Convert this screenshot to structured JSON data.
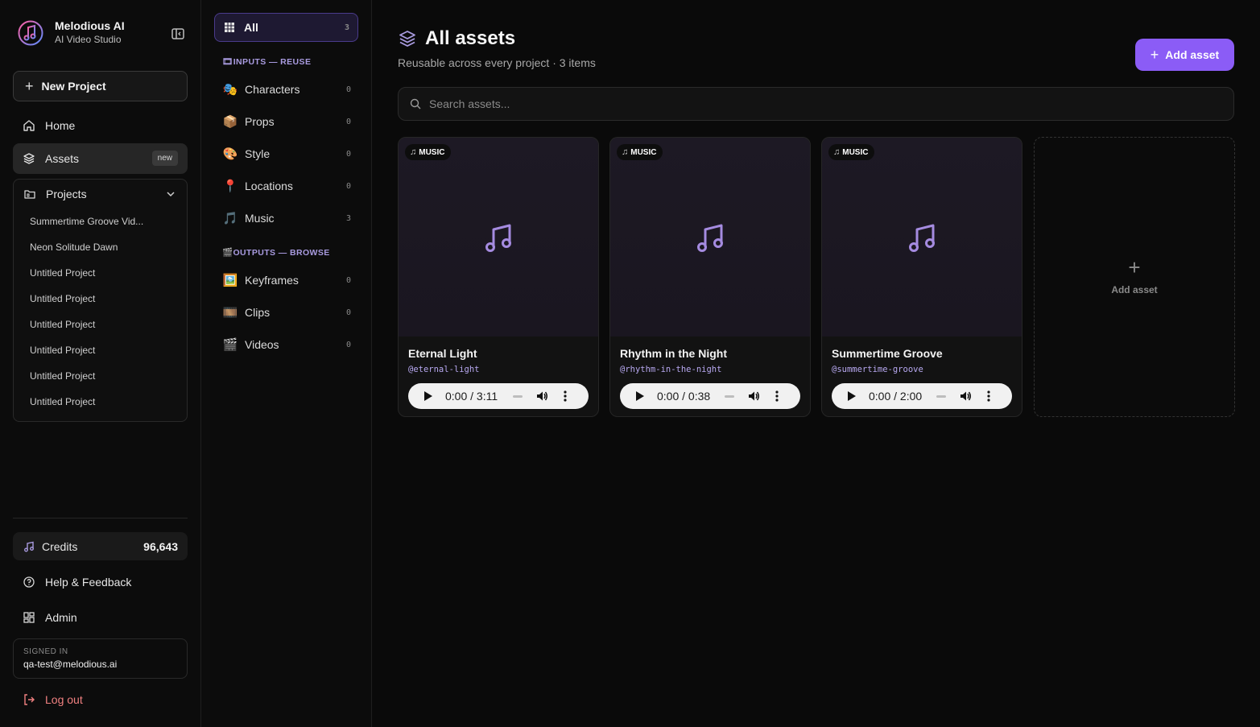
{
  "brand": {
    "name": "Melodious AI",
    "subtitle": "AI Video Studio"
  },
  "sidebar": {
    "new_project": "New Project",
    "home": "Home",
    "assets": "Assets",
    "assets_badge": "new",
    "projects_label": "Projects",
    "projects": [
      "Summertime Groove Vid...",
      "Neon Solitude Dawn",
      "Untitled Project",
      "Untitled Project",
      "Untitled Project",
      "Untitled Project",
      "Untitled Project",
      "Untitled Project"
    ],
    "credits_label": "Credits",
    "credits_value": "96,643",
    "help": "Help & Feedback",
    "admin": "Admin",
    "signed_in_label": "SIGNED IN",
    "signed_in_email": "qa-test@melodious.ai",
    "logout": "Log out"
  },
  "categories": {
    "all": {
      "label": "All",
      "count": "3"
    },
    "inputs_heading": "INPUTS — REUSE",
    "inputs": [
      {
        "emoji": "🎭",
        "label": "Characters",
        "count": "0"
      },
      {
        "emoji": "📦",
        "label": "Props",
        "count": "0"
      },
      {
        "emoji": "🎨",
        "label": "Style",
        "count": "0"
      },
      {
        "emoji": "📍",
        "label": "Locations",
        "count": "0"
      },
      {
        "emoji": "🎵",
        "label": "Music",
        "count": "3"
      }
    ],
    "outputs_heading": "OUTPUTS — BROWSE",
    "outputs": [
      {
        "emoji": "🖼️",
        "label": "Keyframes",
        "count": "0"
      },
      {
        "emoji": "🎞️",
        "label": "Clips",
        "count": "0"
      },
      {
        "emoji": "🎬",
        "label": "Videos",
        "count": "0"
      }
    ]
  },
  "main": {
    "title": "All assets",
    "subtitle": "Reusable across every project · 3 items",
    "add_button": "Add asset",
    "search_placeholder": "Search assets...",
    "add_card_label": "Add asset",
    "assets": [
      {
        "type": "MUSIC",
        "title": "Eternal Light",
        "slug": "@eternal-light",
        "time": "0:00 / 3:11"
      },
      {
        "type": "MUSIC",
        "title": "Rhythm in the Night",
        "slug": "@rhythm-in-the-night",
        "time": "0:00 / 0:38"
      },
      {
        "type": "MUSIC",
        "title": "Summertime Groove",
        "slug": "@summertime-groove",
        "time": "0:00 / 2:00"
      }
    ]
  },
  "colors": {
    "accent": "#8b5cf6",
    "accent_text": "#b7a8f0",
    "logout": "#f08080"
  }
}
